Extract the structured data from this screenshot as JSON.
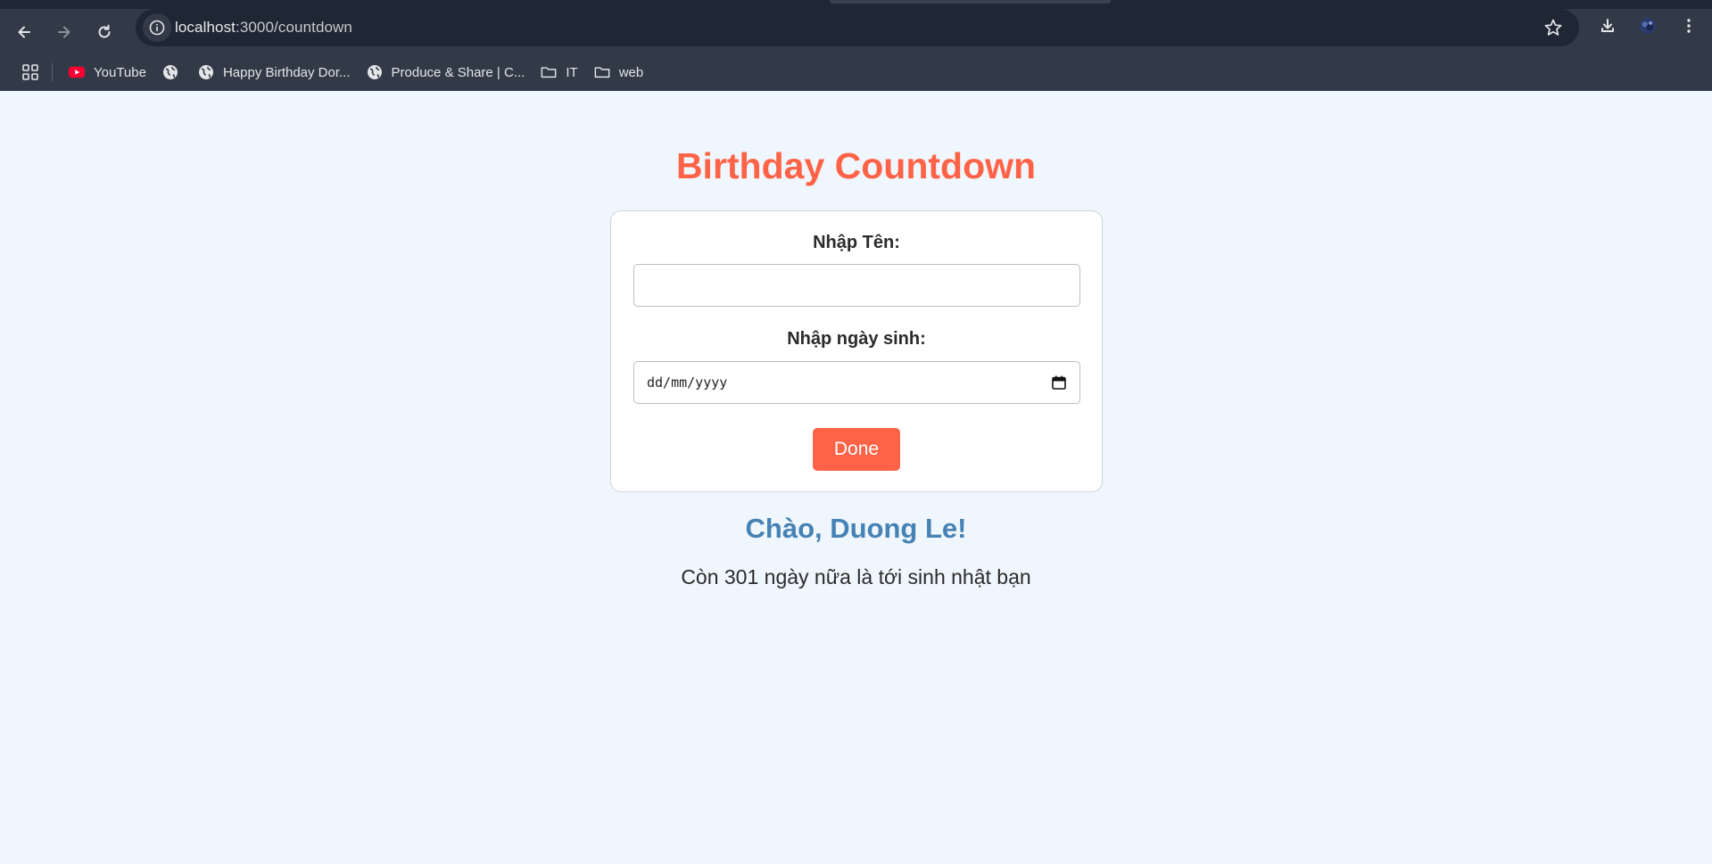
{
  "browser": {
    "url_host": "localhost",
    "url_path": ":3000/countdown",
    "bookmarks": [
      {
        "label": "YouTube",
        "icon": "youtube-icon"
      },
      {
        "label": "",
        "icon": "globe-icon"
      },
      {
        "label": "Happy Birthday Dor...",
        "icon": "globe-icon"
      },
      {
        "label": "Produce & Share | C...",
        "icon": "globe-icon"
      },
      {
        "label": "IT",
        "icon": "folder-icon"
      },
      {
        "label": "web",
        "icon": "folder-icon"
      }
    ]
  },
  "page": {
    "title": "Birthday Countdown",
    "name_label": "Nhập Tên:",
    "name_value": "",
    "dob_label": "Nhập ngày sinh:",
    "dob_placeholder": "dd/mm/yyyy",
    "done_label": "Done",
    "greeting": "Chào, Duong Le!",
    "countdown_text": "Còn 301 ngày nữa là tới sinh nhật bạn"
  },
  "colors": {
    "accent": "#ff6347",
    "greeting": "#4682b4",
    "page_bg": "#eff6fd",
    "chrome_bg": "#323a48"
  }
}
